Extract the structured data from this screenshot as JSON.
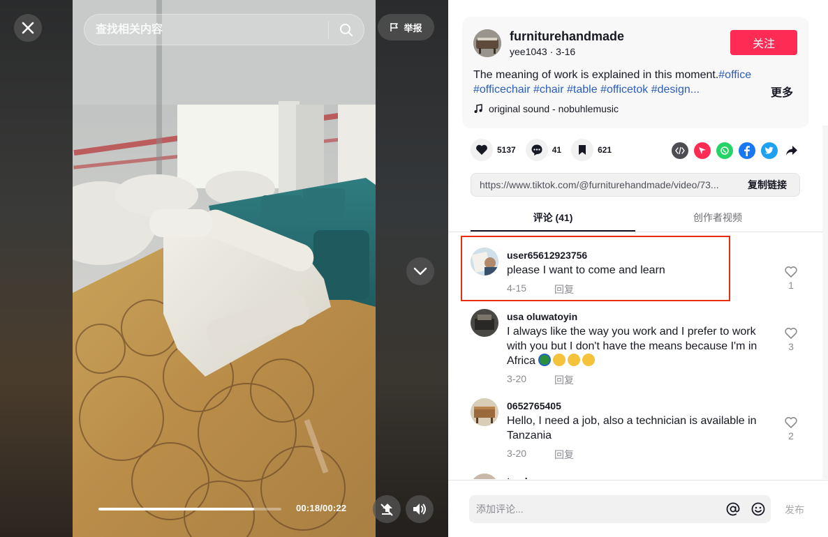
{
  "video": {
    "search_placeholder": "查找相关内容",
    "report_label": "举报",
    "current_time": "00:18",
    "duration": "00:22",
    "time_text": "00:18/00:22",
    "progress_fraction": 0.85,
    "icons": {
      "close": "close-icon",
      "search": "search-icon",
      "report": "flag-icon",
      "next": "chevron-down-icon",
      "float": "floating-player-icon",
      "volume": "volume-icon"
    }
  },
  "post": {
    "author_name": "furniturehandmade",
    "author_meta": "yee1043 · 3-16",
    "follow_label": "关注",
    "description_text": "The meaning of work is explained in this moment.",
    "hashtags": [
      "#office",
      "#officechair",
      "#chair",
      "#table",
      "#officetok",
      "#design..."
    ],
    "more_label": "更多",
    "music": "original sound - nobuhlemusic"
  },
  "actions": {
    "likes": "5137",
    "comments": "41",
    "saves": "621",
    "share_icons": [
      "embed-icon",
      "send-icon",
      "whatsapp-icon",
      "facebook-icon",
      "twitter-icon",
      "share-arrow-icon"
    ]
  },
  "link": {
    "url": "https://www.tiktok.com/@furniturehandmade/video/73...",
    "copy_label": "复制链接"
  },
  "tabs": [
    {
      "label": "评论 (41)",
      "active": true
    },
    {
      "label": "创作者视频",
      "active": false
    }
  ],
  "comments": [
    {
      "user": "user65612923756",
      "text": "please I want to come and learn",
      "date": "4-15",
      "reply": "回复",
      "likes": "1"
    },
    {
      "user": "usa oluwatoyin",
      "text": "I always like the way you work and I prefer to work with you but I don't have the means because I'm in Africa",
      "emojis": [
        "🌍",
        "😞",
        "😞",
        "😞"
      ],
      "date": "3-20",
      "reply": "回复",
      "likes": "3"
    },
    {
      "user": "0652765405",
      "text": "Hello, I need a job, also a technician is available in Tanzania",
      "date": "3-20",
      "reply": "回复",
      "likes": "2"
    },
    {
      "user": "tender"
    }
  ],
  "composer": {
    "placeholder": "添加评论...",
    "post_label": "发布"
  },
  "colors": {
    "accent": "#fe2c55",
    "hashtag": "#2b5db9",
    "highlight": "#ea2d10",
    "whatsapp": "#25d366",
    "facebook": "#1877f2",
    "twitter": "#1da1f2",
    "send": "#fe2c55"
  }
}
